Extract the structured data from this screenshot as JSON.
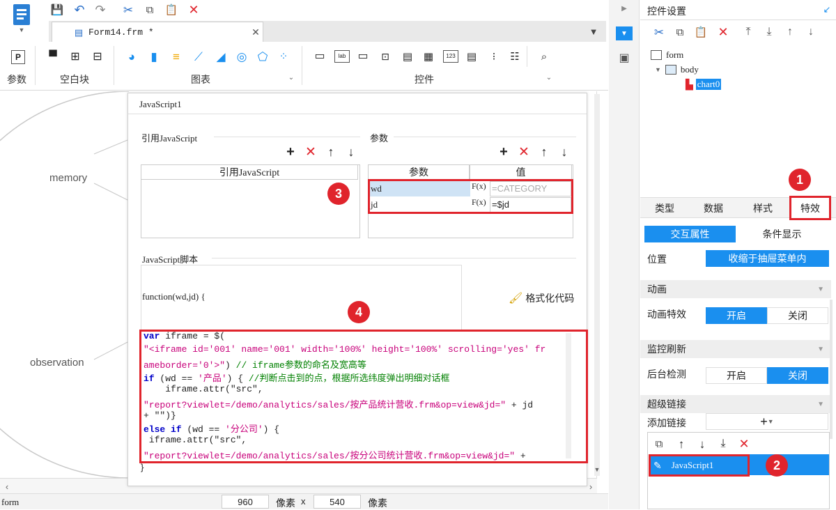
{
  "ribbon": {
    "doc_tab": "Form14.frm *",
    "groups": {
      "param": "参数",
      "blank": "空白块",
      "chart": "图表",
      "widget": "控件"
    }
  },
  "canvas": {
    "labels": {
      "memory": "memory",
      "observation": "observation"
    }
  },
  "dialog": {
    "title": "JavaScript1",
    "ref_section": "引用JavaScript",
    "ref_col": "引用JavaScript",
    "param_section": "参数",
    "param_col": "参数",
    "value_col": "值",
    "params": [
      {
        "name": "wd",
        "value": "=CATEGORY"
      },
      {
        "name": "jd",
        "value": "=$jd"
      }
    ],
    "fx_label": "F(x)",
    "script_section": "JavaScript脚本",
    "function_sig": "function(wd,jd) {",
    "format_button": "格式化代码",
    "closing_brace": "}",
    "code": {
      "l1_kw": "var",
      "l1_rest": " iframe = $(",
      "l2_str": "\"<iframe id='001' name='001' width='100%' height='100%' scrolling='yes' fr",
      "l3_str": "ameborder='0'>\"",
      "l3_rest": ") ",
      "l3_cmt": "// iframe参数的命名及宽高等",
      "l4_kw": "if",
      "l4_a": " (wd == ",
      "l4_str": "'产品'",
      "l4_b": ") {    ",
      "l4_cmt": "//判断点击到的点，根据所选纬度弹出明细对话框",
      "l5": "    iframe.attr(\"src\",",
      "l6_str": "\"report?viewlet=/demo/analytics/sales/按产品统计营收.frm&op=view&jd=\"",
      "l6_rest": " + jd",
      "l7": "+ \"\")}",
      "l8_kw": "else if",
      "l8_a": " (wd == ",
      "l8_str": "'分公司'",
      "l8_b": ") {",
      "l9": " iframe.attr(\"src\",",
      "l10_str": "\"report?viewlet=/demo/analytics/sales/按分公司统计营收.frm&op=view&jd=\"",
      "l10_rest": " +"
    }
  },
  "badges": {
    "b1": "1",
    "b2": "2",
    "b3": "3",
    "b4": "4"
  },
  "status": {
    "form_label": "form",
    "width": "960",
    "unit1": "像素",
    "times": "x",
    "height": "540",
    "unit2": "像素"
  },
  "panel": {
    "title": "控件设置",
    "tree": {
      "form": "form",
      "body": "body",
      "chart": "chart0"
    },
    "tabs": {
      "type": "类型",
      "data": "数据",
      "style": "样式",
      "effect": "特效"
    },
    "subtabs": {
      "interactive": "交互属性",
      "conditional": "条件显示"
    },
    "position_label": "位置",
    "position_value": "收缩于抽屉菜单内",
    "animation_head": "动画",
    "animation_label": "动画特效",
    "on": "开启",
    "off": "关闭",
    "monitor_head": "监控刷新",
    "monitor_label": "后台检测",
    "hyperlink_head": "超级链接",
    "add_link_label": "添加链接",
    "link_item": "JavaScript1"
  },
  "colors": {
    "accent": "#1a8fef",
    "highlight": "#e0242c"
  }
}
